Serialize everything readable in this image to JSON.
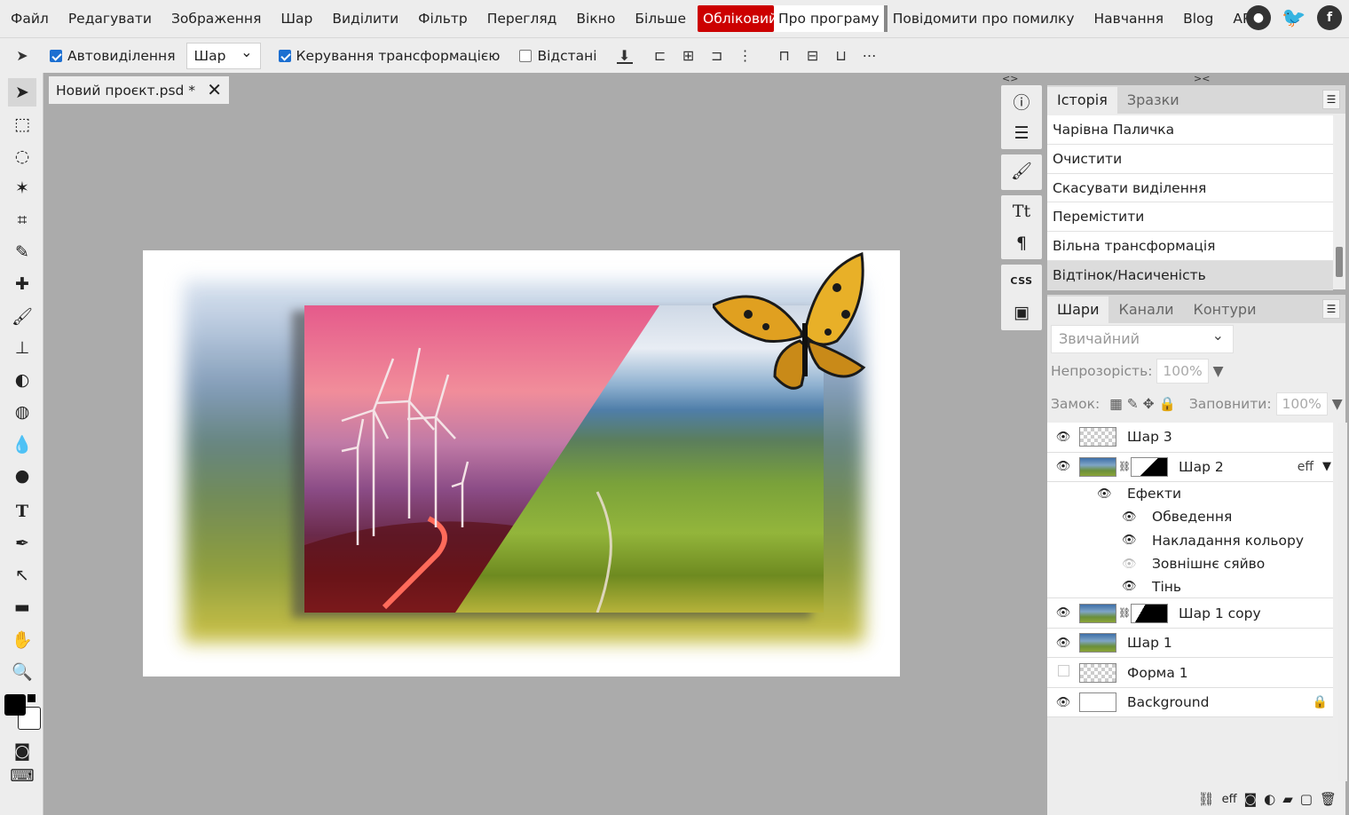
{
  "menu": {
    "items": [
      "Файл",
      "Редагувати",
      "Зображення",
      "Шар",
      "Виділити",
      "Фільтр",
      "Перегляд",
      "Вікно",
      "Більше"
    ],
    "account": "Обліковий",
    "about": "Про програму",
    "report": "Повідомити про помилку",
    "learn": "Навчання",
    "blog": "Blog",
    "api": "API"
  },
  "options": {
    "auto_select_label": "Автовиділення",
    "auto_select_checked": true,
    "layer_select_value": "Шар",
    "transform_label": "Керування трансформацією",
    "transform_checked": true,
    "distances_label": "Відстані",
    "distances_checked": false
  },
  "document": {
    "tab_title": "Новий проєкт.psd *"
  },
  "history": {
    "tabs": [
      "Історія",
      "Зразки"
    ],
    "items": [
      "Чарівна Паличка",
      "Очистити",
      "Скасувати виділення",
      "Перемістити",
      "Вільна трансформація",
      "Відтінок/Насиченість"
    ]
  },
  "layers_panel": {
    "tabs": [
      "Шари",
      "Канали",
      "Контури"
    ],
    "blend_mode": "Звичайний",
    "opacity_label": "Непрозорість:",
    "opacity_value": "100%",
    "lock_label": "Замок:",
    "fill_label": "Заповнити:",
    "fill_value": "100%",
    "layers": [
      {
        "name": "Шар 3"
      },
      {
        "name": "Шар 2",
        "badge": "eff"
      },
      {
        "name": "Шар 1 copy"
      },
      {
        "name": "Шар 1"
      },
      {
        "name": "Форма 1"
      },
      {
        "name": "Background"
      }
    ],
    "effects_label": "Ефекти",
    "effects": [
      "Обведення",
      "Накладання кольору",
      "Зовнішнє сяйво",
      "Тінь"
    ]
  },
  "colors": {
    "foreground": "#000000",
    "background": "#ffffff",
    "account_button": "#cc0000",
    "panel_bg": "#ededed",
    "workspace_bg": "#ababab"
  }
}
